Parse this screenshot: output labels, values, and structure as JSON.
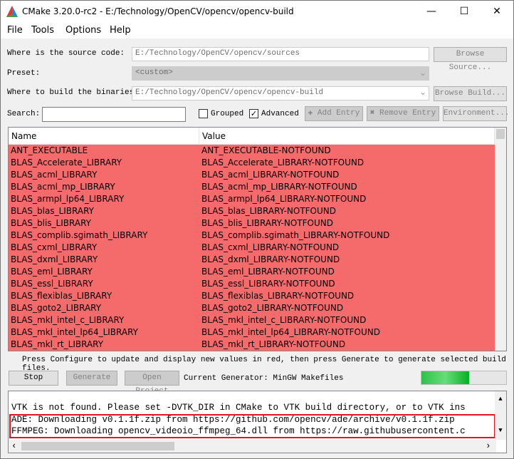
{
  "window": {
    "title": "CMake 3.20.0-rc2 - E:/Technology/OpenCV/opencv/opencv-build",
    "minimize": "—",
    "maximize": "☐",
    "close": "✕"
  },
  "menu": [
    "File",
    "Tools",
    "Options",
    "Help"
  ],
  "source": {
    "label": "Where is the source code:",
    "value": "E:/Technology/OpenCV/opencv/sources",
    "button": "Browse Source..."
  },
  "preset": {
    "label": "Preset:",
    "value": "<custom>"
  },
  "build": {
    "label": "Where to build the binaries:",
    "value": "E:/Technology/OpenCV/opencv/opencv-build",
    "button": "Browse Build..."
  },
  "search": {
    "label": "Search:",
    "value": ""
  },
  "options": {
    "grouped": {
      "label": "Grouped",
      "checked": false
    },
    "advanced": {
      "label": "Advanced",
      "checked": true
    }
  },
  "buttons": {
    "add": "Add Entry",
    "remove": "Remove Entry",
    "environment": "Environment...",
    "stop": "Stop",
    "generate": "Generate",
    "open_project": "Open Project"
  },
  "table": {
    "headers": [
      "Name",
      "Value"
    ],
    "rows": [
      [
        "ANT_EXECUTABLE",
        "ANT_EXECUTABLE-NOTFOUND"
      ],
      [
        "BLAS_Accelerate_LIBRARY",
        "BLAS_Accelerate_LIBRARY-NOTFOUND"
      ],
      [
        "BLAS_acml_LIBRARY",
        "BLAS_acml_LIBRARY-NOTFOUND"
      ],
      [
        "BLAS_acml_mp_LIBRARY",
        "BLAS_acml_mp_LIBRARY-NOTFOUND"
      ],
      [
        "BLAS_armpl_lp64_LIBRARY",
        "BLAS_armpl_lp64_LIBRARY-NOTFOUND"
      ],
      [
        "BLAS_blas_LIBRARY",
        "BLAS_blas_LIBRARY-NOTFOUND"
      ],
      [
        "BLAS_blis_LIBRARY",
        "BLAS_blis_LIBRARY-NOTFOUND"
      ],
      [
        "BLAS_complib.sgimath_LIBRARY",
        "BLAS_complib.sgimath_LIBRARY-NOTFOUND"
      ],
      [
        "BLAS_cxml_LIBRARY",
        "BLAS_cxml_LIBRARY-NOTFOUND"
      ],
      [
        "BLAS_dxml_LIBRARY",
        "BLAS_dxml_LIBRARY-NOTFOUND"
      ],
      [
        "BLAS_eml_LIBRARY",
        "BLAS_eml_LIBRARY-NOTFOUND"
      ],
      [
        "BLAS_essl_LIBRARY",
        "BLAS_essl_LIBRARY-NOTFOUND"
      ],
      [
        "BLAS_flexiblas_LIBRARY",
        "BLAS_flexiblas_LIBRARY-NOTFOUND"
      ],
      [
        "BLAS_goto2_LIBRARY",
        "BLAS_goto2_LIBRARY-NOTFOUND"
      ],
      [
        "BLAS_mkl_intel_c_LIBRARY",
        "BLAS_mkl_intel_c_LIBRARY-NOTFOUND"
      ],
      [
        "BLAS_mkl_intel_lp64_LIBRARY",
        "BLAS_mkl_intel_lp64_LIBRARY-NOTFOUND"
      ],
      [
        "BLAS_mkl_rt_LIBRARY",
        "BLAS_mkl_rt_LIBRARY-NOTFOUND"
      ]
    ]
  },
  "hint": "Press Configure to update and display new values in red, then press Generate to generate selected build files.",
  "generator": "Current Generator: MinGW Makefiles",
  "progress": 0.56,
  "output": [
    "VTK is not found. Please set -DVTK_DIR in CMake to VTK build directory, or to VTK ins",
    "ADE: Downloading v0.1.1f.zip from https://github.com/opencv/ade/archive/v0.1.1f.zip",
    "FFMPEG: Downloading opencv_videoio_ffmpeg_64.dll from https://raw.githubusercontent.c"
  ],
  "colors": {
    "row_red": "#f56a6a",
    "highlight": "#e81123",
    "progress": "#06b025"
  }
}
